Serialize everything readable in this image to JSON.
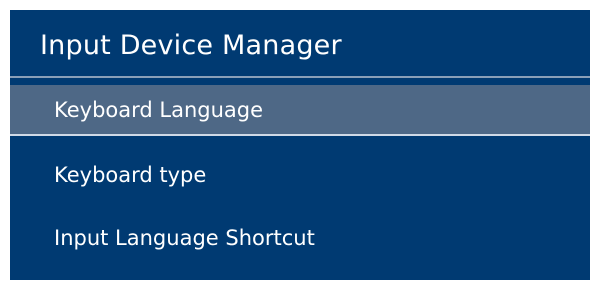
{
  "menu": {
    "title": "Input Device Manager",
    "items": [
      {
        "label": "Keyboard Language",
        "selected": true
      },
      {
        "label": "Keyboard type",
        "selected": false
      },
      {
        "label": "Input Language Shortcut",
        "selected": false
      }
    ]
  },
  "colors": {
    "panel_background": "#003a72",
    "selected_item_background": "#4e6886",
    "text": "#ffffff"
  }
}
